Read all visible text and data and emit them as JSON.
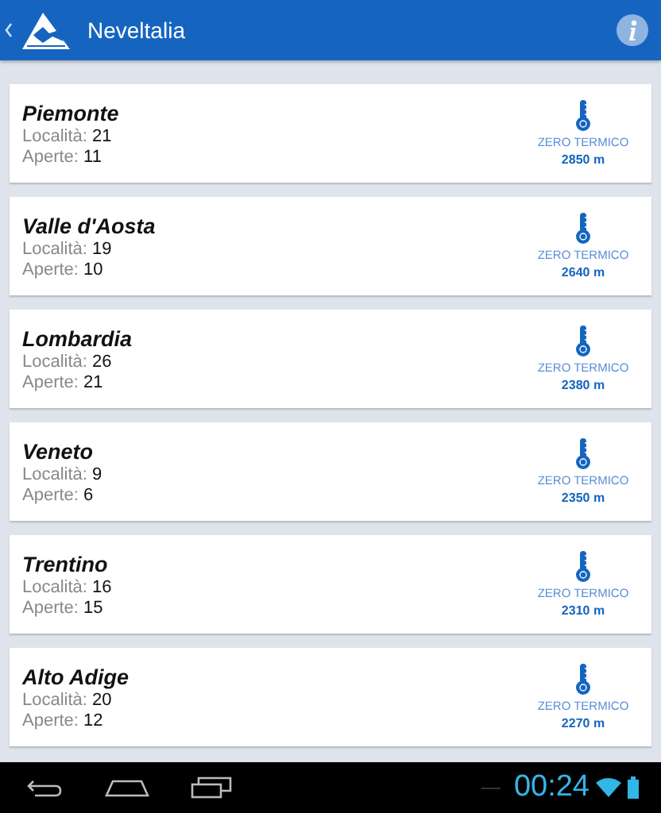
{
  "app_bar": {
    "title": "Neveltalia"
  },
  "regions": [
    {
      "name": "Piemonte",
      "localita_label": "Località:",
      "localita": "21",
      "aperte_label": "Aperte:",
      "aperte": "11",
      "zero_label": "ZERO TERMICO",
      "zero": "2850 m"
    },
    {
      "name": "Valle d'Aosta",
      "localita_label": "Località:",
      "localita": "19",
      "aperte_label": "Aperte:",
      "aperte": "10",
      "zero_label": "ZERO TERMICO",
      "zero": "2640 m"
    },
    {
      "name": "Lombardia",
      "localita_label": "Località:",
      "localita": "26",
      "aperte_label": "Aperte:",
      "aperte": "21",
      "zero_label": "ZERO TERMICO",
      "zero": "2380 m"
    },
    {
      "name": "Veneto",
      "localita_label": "Località:",
      "localita": "9",
      "aperte_label": "Aperte:",
      "aperte": "6",
      "zero_label": "ZERO TERMICO",
      "zero": "2350 m"
    },
    {
      "name": "Trentino",
      "localita_label": "Località:",
      "localita": "16",
      "aperte_label": "Aperte:",
      "aperte": "15",
      "zero_label": "ZERO TERMICO",
      "zero": "2310 m"
    },
    {
      "name": "Alto Adige",
      "localita_label": "Località:",
      "localita": "20",
      "aperte_label": "Aperte:",
      "aperte": "12",
      "zero_label": "ZERO TERMICO",
      "zero": "2270 m"
    }
  ],
  "system_bar": {
    "time": "00:24"
  }
}
